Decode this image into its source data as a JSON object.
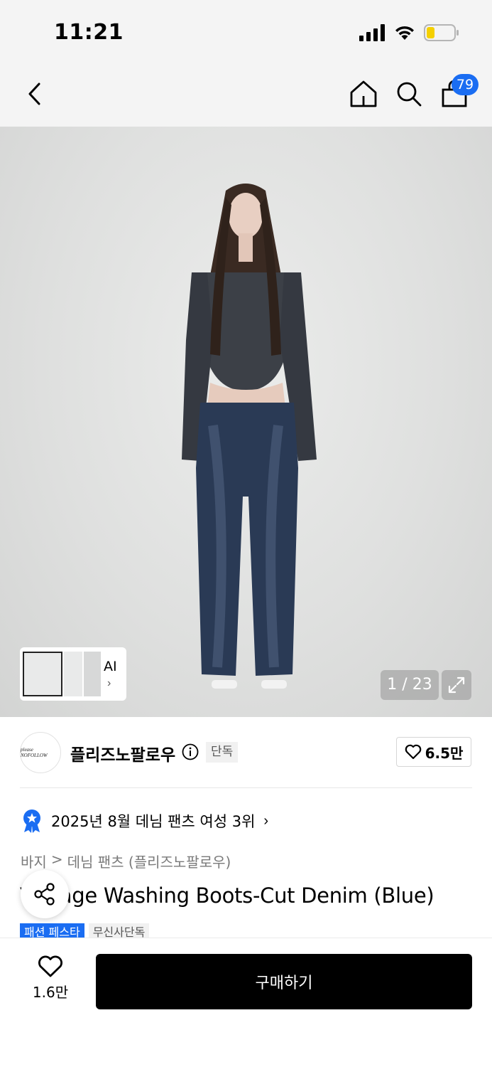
{
  "status_bar": {
    "time": "11:21"
  },
  "nav": {
    "cart_count": "79"
  },
  "hero": {
    "ai_label": "AI",
    "ai_chevron": "›",
    "page_counter": "1 / 23"
  },
  "brand": {
    "logo_text": "please NOFOLLOW",
    "name": "플리즈노팔로우",
    "exclusive_badge": "단독",
    "likes": "6.5만"
  },
  "ranking": {
    "text": "2025년 8월 데님 팬츠 여성 3위",
    "chevron": "›"
  },
  "breadcrumb": {
    "items": [
      "바지",
      "데님 팬츠 (플리즈노팔로우)"
    ],
    "separator": ">"
  },
  "product": {
    "title": "Vintage Washing Boots-Cut Denim (Blue)",
    "tags": [
      "패션 페스타",
      "무신사단독"
    ]
  },
  "bottom_bar": {
    "like_count": "1.6만",
    "buy_label": "구매하기"
  },
  "icons": {
    "back": "back-arrow-icon",
    "home": "home-icon",
    "search": "search-icon",
    "cart": "shopping-bag-icon",
    "expand": "expand-icon",
    "info": "info-icon",
    "heart": "heart-icon",
    "share": "share-icon",
    "rank": "ranking-medal-icon"
  },
  "colors": {
    "accent_blue": "#1a6df2",
    "buy_button": "#000000",
    "battery_fill": "#f5d000"
  }
}
